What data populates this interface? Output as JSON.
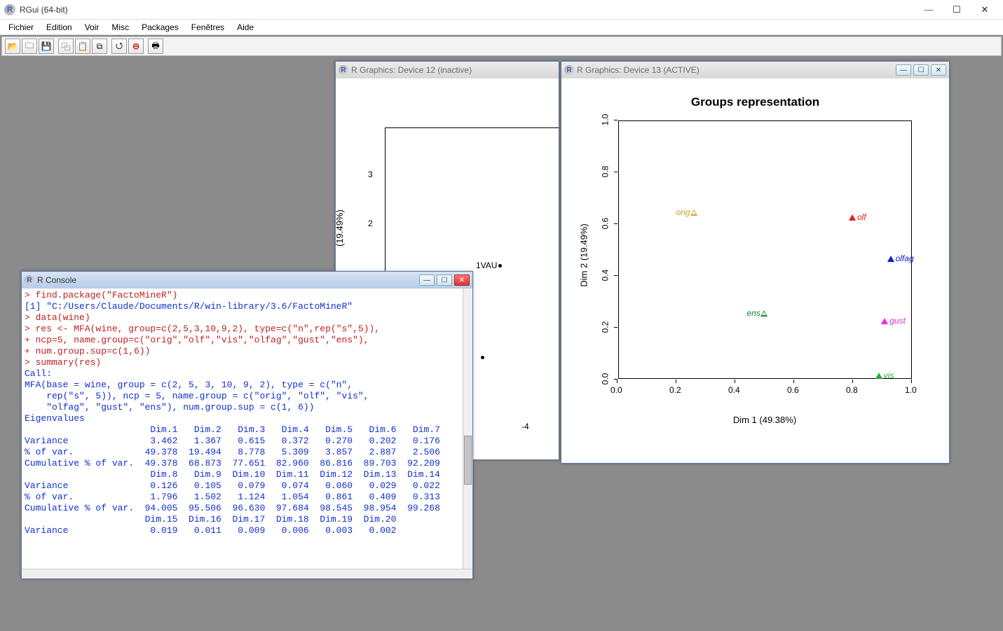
{
  "app": {
    "title": "RGui (64-bit)"
  },
  "menu": {
    "items": [
      "Fichier",
      "Edition",
      "Voir",
      "Misc",
      "Packages",
      "Fenêtres",
      "Aide"
    ]
  },
  "toolbar": {
    "buttons": [
      {
        "name": "open-icon",
        "glyph": "📂"
      },
      {
        "name": "load-workspace-icon",
        "glyph": "🗀"
      },
      {
        "name": "save-icon",
        "glyph": "💾"
      },
      {
        "name": "copy-icon",
        "glyph": "⿻"
      },
      {
        "name": "paste-icon",
        "glyph": "📋"
      },
      {
        "name": "copy-paste-icon",
        "glyph": "⧉"
      },
      {
        "name": "stop-current-icon",
        "glyph": "⭯"
      },
      {
        "name": "stop-all-icon",
        "glyph": "⊝"
      },
      {
        "name": "print-icon",
        "glyph": "🖶"
      }
    ]
  },
  "windows": {
    "console": {
      "title": "R Console",
      "lines": [
        {
          "cls": "",
          "text": ""
        },
        {
          "cls": "c-red",
          "text": "> find.package(\"FactoMineR\")"
        },
        {
          "cls": "c-blue",
          "text": "[1] \"C:/Users/Claude/Documents/R/win-library/3.6/FactoMineR\""
        },
        {
          "cls": "c-red",
          "text": "> data(wine)"
        },
        {
          "cls": "c-red",
          "text": "> res <- MFA(wine, group=c(2,5,3,10,9,2), type=c(\"n\",rep(\"s\",5)),"
        },
        {
          "cls": "c-red",
          "text": "+ ncp=5, name.group=c(\"orig\",\"olf\",\"vis\",\"olfag\",\"gust\",\"ens\"),"
        },
        {
          "cls": "c-red",
          "text": "+ num.group.sup=c(1,6))"
        },
        {
          "cls": "c-red",
          "text": "> summary(res)"
        },
        {
          "cls": "",
          "text": ""
        },
        {
          "cls": "c-blue",
          "text": "Call:"
        },
        {
          "cls": "c-blue",
          "text": "MFA(base = wine, group = c(2, 5, 3, 10, 9, 2), type = c(\"n\", "
        },
        {
          "cls": "c-blue",
          "text": "    rep(\"s\", 5)), ncp = 5, name.group = c(\"orig\", \"olf\", \"vis\", "
        },
        {
          "cls": "c-blue",
          "text": "    \"olfag\", \"gust\", \"ens\"), num.group.sup = c(1, 6)) "
        },
        {
          "cls": "",
          "text": ""
        },
        {
          "cls": "",
          "text": ""
        },
        {
          "cls": "c-blue",
          "text": "Eigenvalues"
        },
        {
          "cls": "c-blue",
          "text": "                       Dim.1   Dim.2   Dim.3   Dim.4   Dim.5   Dim.6   Dim.7"
        },
        {
          "cls": "c-blue",
          "text": "Variance               3.462   1.367   0.615   0.372   0.270   0.202   0.176"
        },
        {
          "cls": "c-blue",
          "text": "% of var.             49.378  19.494   8.778   5.309   3.857   2.887   2.506"
        },
        {
          "cls": "c-blue",
          "text": "Cumulative % of var.  49.378  68.873  77.651  82.960  86.816  89.703  92.209"
        },
        {
          "cls": "c-blue",
          "text": "                       Dim.8   Dim.9  Dim.10  Dim.11  Dim.12  Dim.13  Dim.14"
        },
        {
          "cls": "c-blue",
          "text": "Variance               0.126   0.105   0.079   0.074   0.060   0.029   0.022"
        },
        {
          "cls": "c-blue",
          "text": "% of var.              1.796   1.502   1.124   1.054   0.861   0.409   0.313"
        },
        {
          "cls": "c-blue",
          "text": "Cumulative % of var.  94.005  95.506  96.630  97.684  98.545  98.954  99.268"
        },
        {
          "cls": "c-blue",
          "text": "                      Dim.15  Dim.16  Dim.17  Dim.18  Dim.19  Dim.20"
        },
        {
          "cls": "c-blue",
          "text": "Variance               0.019   0.011   0.009   0.006   0.003   0.002"
        }
      ]
    },
    "gfx12": {
      "title": "R Graphics: Device 12 (inactive)",
      "y_ticks": [
        "2",
        "3"
      ],
      "y_axis_label": "(19.49%)",
      "visible_text_1": "1VAU",
      "visible_x_tick": "-4"
    },
    "gfx13": {
      "title": "R Graphics: Device 13 (ACTIVE)"
    }
  },
  "chart_data": {
    "type": "scatter",
    "title": "Groups representation",
    "xlabel": "Dim 1 (49.38%)",
    "ylabel": "Dim 2 (19.49%)",
    "xlim": [
      0.0,
      1.0
    ],
    "ylim": [
      0.0,
      1.0
    ],
    "x_ticks": [
      0.0,
      0.2,
      0.4,
      0.6,
      0.8,
      1.0
    ],
    "y_ticks": [
      0.0,
      0.2,
      0.4,
      0.6,
      0.8,
      1.0
    ],
    "series": [
      {
        "name": "orig",
        "color": "#c9a227",
        "marker": "open-triangle",
        "x": 0.28,
        "y": 0.65,
        "supplementary": true
      },
      {
        "name": "olf",
        "color": "#e02020",
        "marker": "filled-triangle",
        "x": 0.8,
        "y": 0.63,
        "supplementary": false
      },
      {
        "name": "olfag",
        "color": "#1020c0",
        "marker": "filled-triangle",
        "x": 0.93,
        "y": 0.47,
        "supplementary": false
      },
      {
        "name": "ens",
        "color": "#148828",
        "marker": "open-triangle",
        "x": 0.52,
        "y": 0.26,
        "supplementary": true
      },
      {
        "name": "gust",
        "color": "#e030e0",
        "marker": "filled-triangle",
        "x": 0.91,
        "y": 0.23,
        "supplementary": false
      },
      {
        "name": "vis",
        "color": "#20b030",
        "marker": "filled-triangle",
        "x": 0.89,
        "y": 0.02,
        "supplementary": false
      }
    ]
  }
}
